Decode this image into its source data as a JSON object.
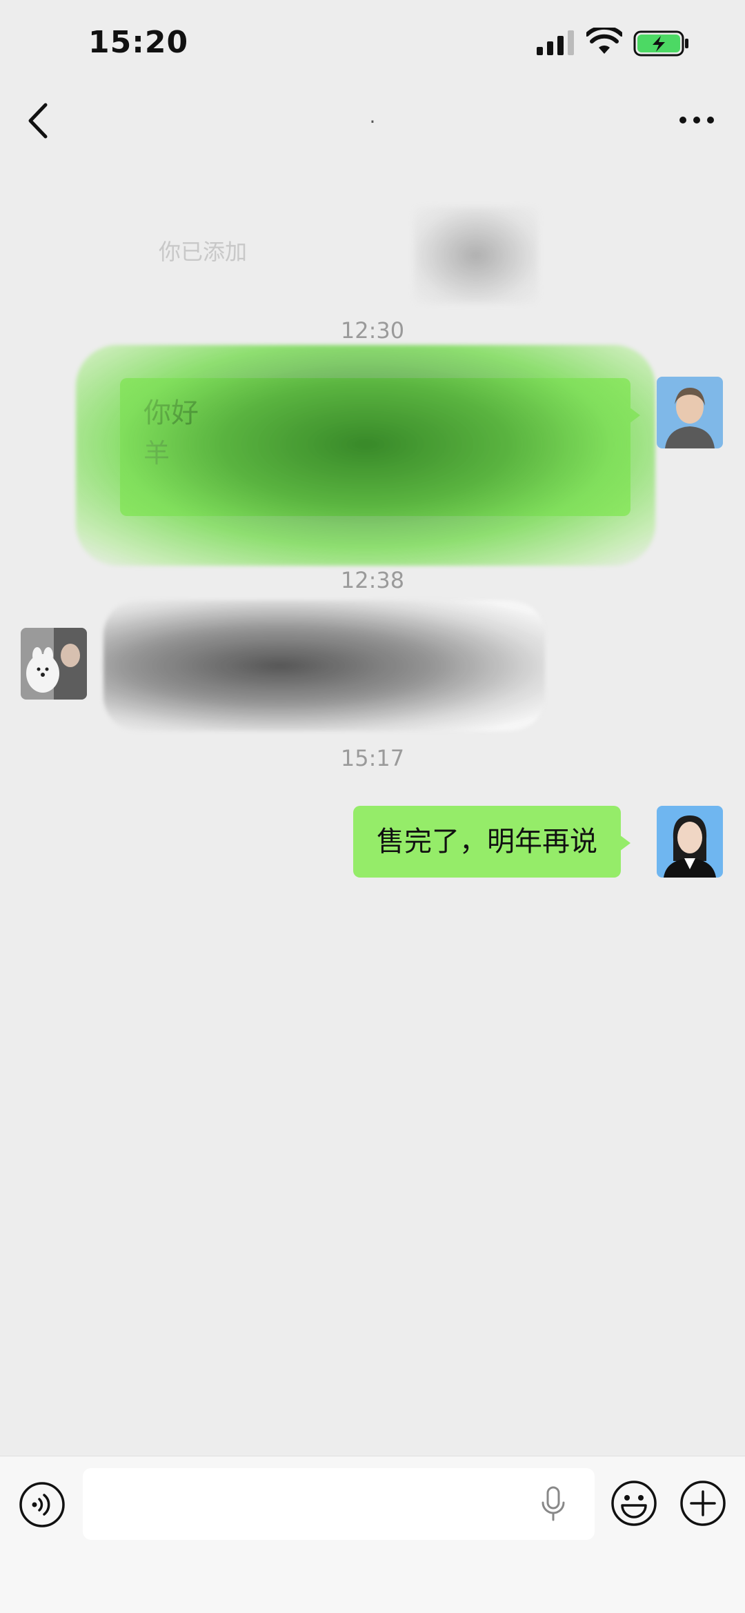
{
  "status_bar": {
    "time": "15:20"
  },
  "nav": {
    "title": "·"
  },
  "messages": [
    {
      "type": "system",
      "text": "你已添加"
    },
    {
      "type": "timestamp",
      "text": "12:30"
    },
    {
      "type": "outgoing",
      "text_line1": "你好",
      "text_line2": "羊"
    },
    {
      "type": "timestamp",
      "text": "12:38"
    },
    {
      "type": "incoming",
      "text": ""
    },
    {
      "type": "timestamp",
      "text": "15:17"
    },
    {
      "type": "outgoing",
      "text": "售完了，明年再说"
    }
  ],
  "input": {
    "value": "",
    "placeholder": ""
  },
  "colors": {
    "background": "#ededed",
    "bubble_outgoing": "#95ec69",
    "battery_green": "#4cd964"
  },
  "icons": [
    "back-icon",
    "more-icon",
    "voice-icon",
    "mic-icon",
    "emoji-icon",
    "plus-icon"
  ]
}
